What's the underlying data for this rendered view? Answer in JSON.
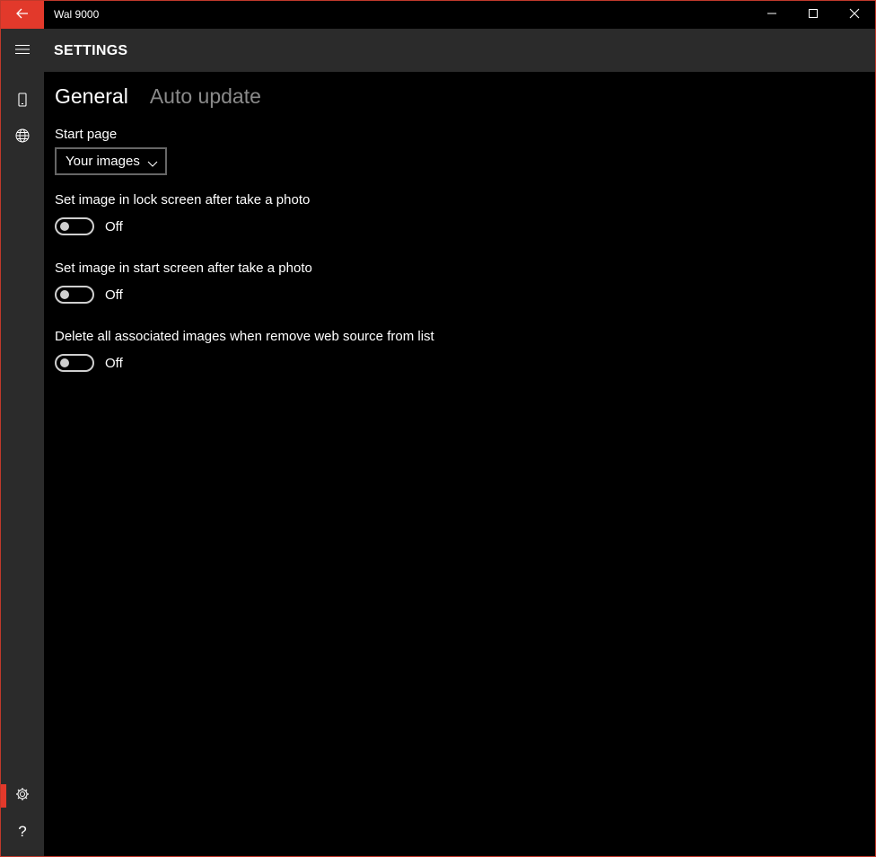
{
  "window": {
    "title": "Wal 9000",
    "accent": "#e2392b"
  },
  "header": {
    "title": "SETTINGS"
  },
  "rail": {
    "items": [
      {
        "icon": "hamburger-menu-icon"
      },
      {
        "icon": "phone-icon"
      },
      {
        "icon": "globe-icon"
      },
      {
        "icon": "gear-icon",
        "selected": true
      },
      {
        "icon": "help-icon",
        "glyph": "?"
      }
    ]
  },
  "tabs": [
    {
      "label": "General",
      "active": true
    },
    {
      "label": "Auto update",
      "active": false
    }
  ],
  "settings": {
    "start_page": {
      "label": "Start page",
      "value": "Your images"
    },
    "toggles": [
      {
        "label": "Set image in lock screen after take a photo",
        "state": "Off"
      },
      {
        "label": "Set image in start screen after take a photo",
        "state": "Off"
      },
      {
        "label": "Delete all associated images when remove web source from list",
        "state": "Off"
      }
    ]
  }
}
